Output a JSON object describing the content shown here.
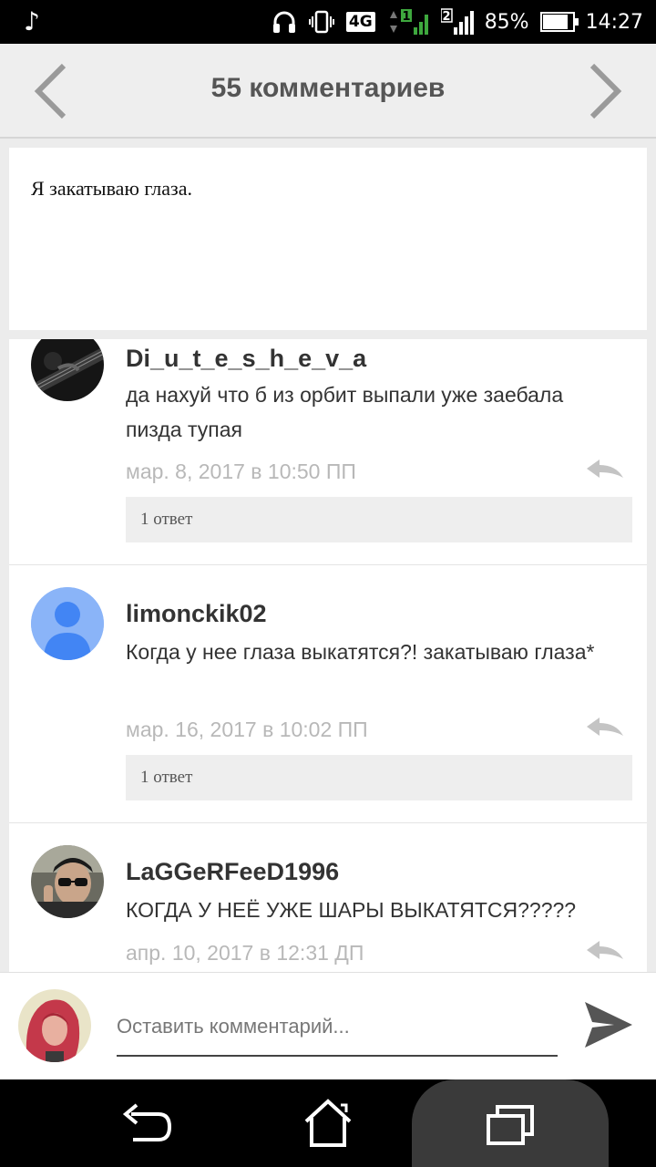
{
  "status_bar": {
    "music_icon": "♪",
    "network": "4G",
    "sim1": "1",
    "sim2": "2",
    "battery_percent": "85%",
    "battery_level": 0.85,
    "time": "14:27"
  },
  "header": {
    "title": "55 комментариев"
  },
  "post": {
    "text": "Я закатываю глаза."
  },
  "comments": [
    {
      "author": "Di_u_t_e_s_h_e_v_a",
      "text": "да нахуй что б из орбит выпали уже заебала пизда тупая",
      "date": "мар. 8, 2017 в 10:50 ПП",
      "replies": "1 ответ",
      "avatar": "guitar-photo"
    },
    {
      "author": "limonckik02",
      "text": "Когда у нее глаза выкатятся?! закатываю глаза*",
      "date": "мар. 16, 2017 в 10:02 ПП",
      "replies": "1 ответ",
      "avatar": "default-person"
    },
    {
      "author": "LaGGeRFeeD1996",
      "text": "КОГДА У НЕЁ УЖЕ ШАРЫ ВЫКАТЯТСЯ?????",
      "date": "апр. 10, 2017 в 12:31 ДП",
      "replies": "",
      "avatar": "sunglasses-photo"
    }
  ],
  "compose": {
    "placeholder": "Оставить комментарий..."
  },
  "colors": {
    "header_bg": "#eeeeee",
    "date_gray": "#b8b8b8",
    "default_avatar_bg": "#8ab4f8",
    "default_avatar_fg": "#4285f4"
  }
}
